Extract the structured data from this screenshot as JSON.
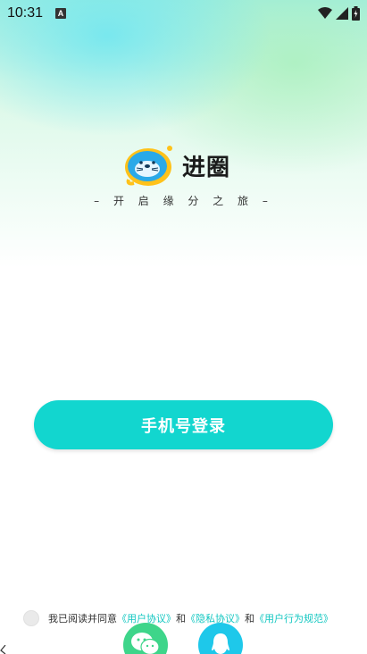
{
  "status_bar": {
    "time": "10:31",
    "notification_icon": "A",
    "icons": [
      "wifi-icon",
      "signal-icon",
      "battery-icon"
    ]
  },
  "brand": {
    "name": "进圈",
    "slogan": "– 开 启 缘 分 之 旅 –"
  },
  "login": {
    "phone_button": "手机号登录"
  },
  "agreement": {
    "prefix": "我已阅读并同意",
    "user_agreement": "《用户协议》",
    "and1": "和",
    "privacy": "《隐私协议》",
    "and2": "和",
    "behavior": "《用户行为规范》"
  },
  "social": {
    "wechat_icon": "wechat-icon",
    "qq_icon": "qq-icon"
  },
  "colors": {
    "accent": "#12d6cf",
    "link": "#12c7c1",
    "wechat": "#3ed58a",
    "qq": "#1ec8ea"
  }
}
